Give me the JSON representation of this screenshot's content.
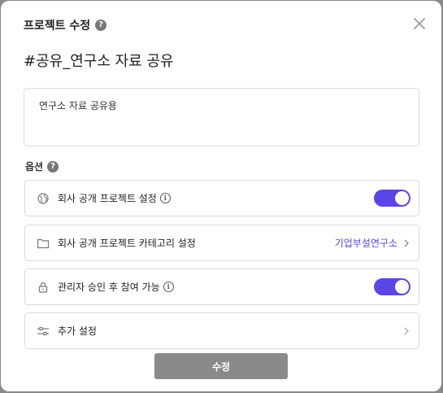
{
  "modal": {
    "title": "프로젝트 수정",
    "help_symbol": "?",
    "project_name": "#공유_연구소 자료 공유",
    "description": "연구소 자료 공유용"
  },
  "options": {
    "label": "옵션",
    "help_symbol": "?",
    "rows": [
      {
        "label": "회사 공개 프로젝트 설정",
        "info_symbol": "i",
        "toggle_on": true
      },
      {
        "label": "회사 공개 프로젝트 카테고리 설정",
        "value": "기업부설연구소"
      },
      {
        "label": "관리자 승인 후 참여 가능",
        "info_symbol": "i",
        "toggle_on": true
      },
      {
        "label": "추가 설정"
      }
    ]
  },
  "submit_label": "수정",
  "colors": {
    "accent": "#5b45e6",
    "button": "#8a8a8a"
  }
}
